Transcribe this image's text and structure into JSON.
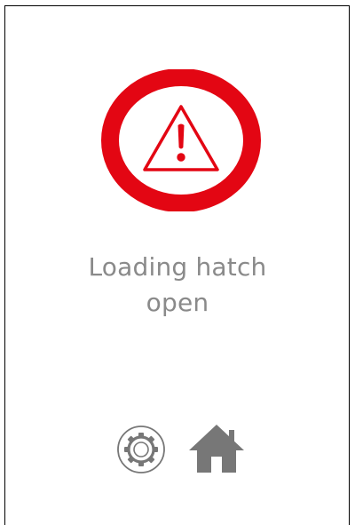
{
  "alert": {
    "icon": "warning-triangle-icon",
    "ring_color": "#e30613",
    "message_line1": "Loading hatch",
    "message_line2": "open",
    "text_color": "#8a8a8a"
  },
  "toolbar": {
    "settings_icon": "gear-icon",
    "home_icon": "home-icon",
    "icon_color": "#777777"
  }
}
